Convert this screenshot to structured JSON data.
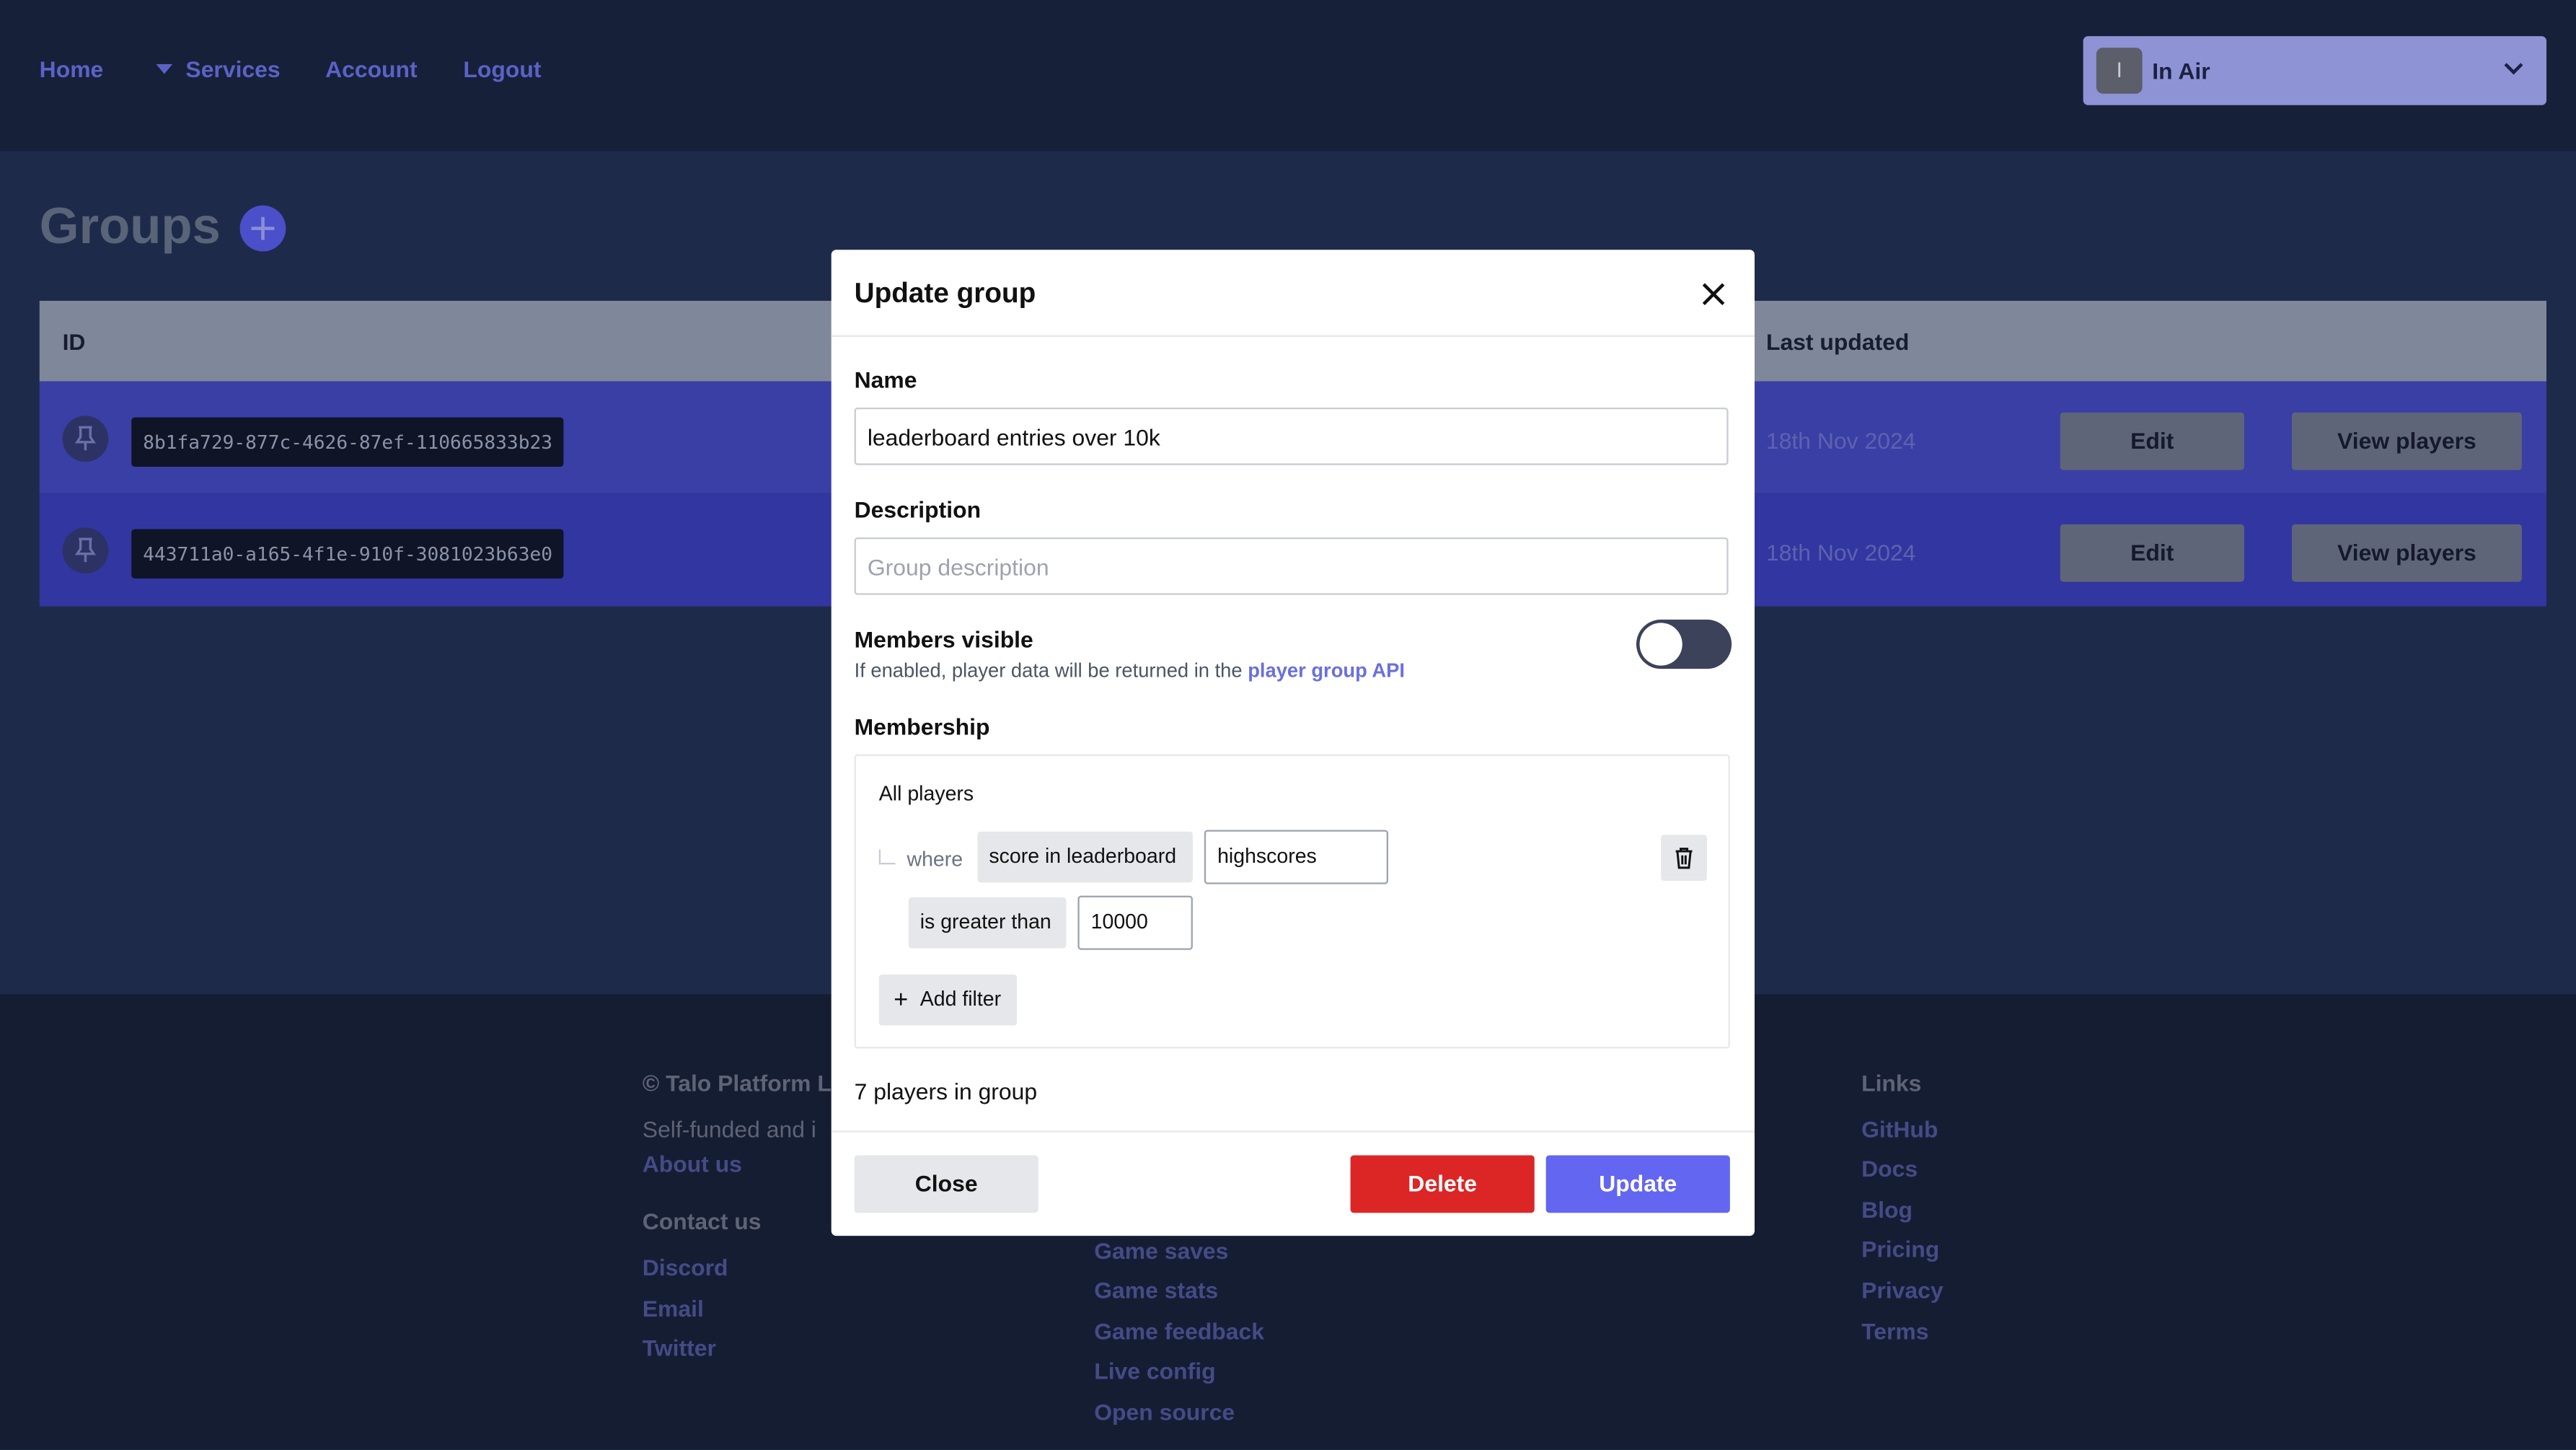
{
  "nav": {
    "home": "Home",
    "services": "Services",
    "account": "Account",
    "logout": "Logout"
  },
  "game_select": {
    "avatar_letter": "I",
    "name": "In Air"
  },
  "page": {
    "title": "Groups"
  },
  "table": {
    "headers": {
      "id": "ID",
      "last_updated": "Last updated"
    },
    "rows": [
      {
        "id": "8b1fa729-877c-4626-87ef-110665833b23",
        "last_updated": "18th Nov 2024",
        "edit": "Edit",
        "view": "View players"
      },
      {
        "id": "443711a0-a165-4f1e-910f-3081023b63e0",
        "last_updated": "18th Nov 2024",
        "edit": "Edit",
        "view": "View players"
      }
    ]
  },
  "footer": {
    "copyright": "© Talo Platform L",
    "tagline": "Self-funded and i",
    "about": "About us",
    "contact_head": "Contact us",
    "contact": [
      "Discord",
      "Email",
      "Twitter"
    ],
    "services_links": [
      "Game saves",
      "Game stats",
      "Game feedback",
      "Live config",
      "Open source"
    ],
    "links_head": "Links",
    "links": [
      "GitHub",
      "Docs",
      "Blog",
      "Pricing",
      "Privacy",
      "Terms"
    ]
  },
  "modal": {
    "title": "Update group",
    "name_label": "Name",
    "name_value": "leaderboard entries over 10k",
    "description_label": "Description",
    "description_placeholder": "Group description",
    "members_visible_label": "Members visible",
    "members_visible_hint": "If enabled, player data will be returned in the",
    "members_visible_link": "player group API",
    "members_visible_on": false,
    "membership_label": "Membership",
    "rules": {
      "root": "All players",
      "where": "where",
      "field": "score in leaderboard",
      "field_value": "highscores",
      "operator": "is greater than",
      "operand": "10000",
      "add_filter": "Add filter"
    },
    "count_text": "7 players in group",
    "close": "Close",
    "delete": "Delete",
    "update": "Update"
  },
  "colors": {
    "accent": "#6366f1",
    "danger": "#dc2626",
    "nav_link": "#5b62c6"
  }
}
